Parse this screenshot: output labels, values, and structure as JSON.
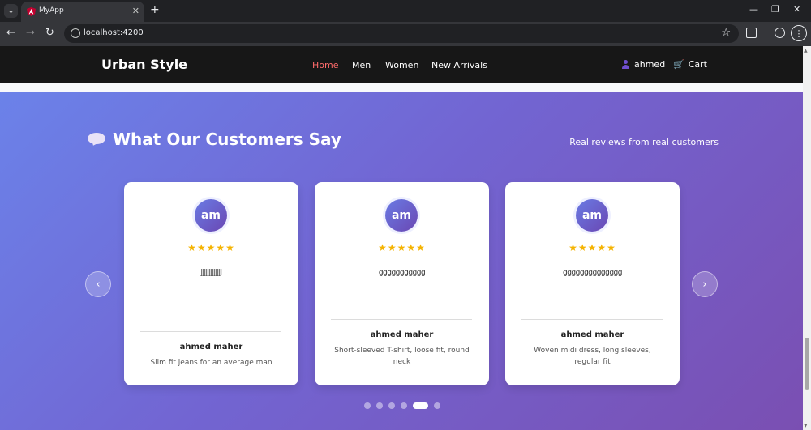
{
  "browser": {
    "tab_title": "MyApp",
    "url": "localhost:4200",
    "tab_close": "✕",
    "new_tab": "+",
    "window": {
      "minimize": "—",
      "maximize": "❐",
      "close": "✕"
    },
    "nav": {
      "back": "←",
      "forward": "→",
      "reload": "↻"
    },
    "star": "☆",
    "menu": "⋮"
  },
  "site": {
    "brand": "Urban Style",
    "nav_links": [
      "Home",
      "Men",
      "Women",
      "New Arrivals"
    ],
    "active_link": "Home",
    "user_name": "ahmed",
    "cart_label": "Cart",
    "cart_icon_glyph": "🛒"
  },
  "reviews": {
    "title": "What Our Customers Say",
    "subtitle": "Real reviews from real customers",
    "prev": "‹",
    "next": "›",
    "cards": [
      {
        "initials": "am",
        "stars": "★★★★★",
        "rating": 5,
        "text": "jjjjjjjjjjjjj",
        "reviewer": "ahmed maher",
        "product": "Slim fit jeans for an average man"
      },
      {
        "initials": "am",
        "stars": "★★★★★",
        "rating": 5,
        "text": "ggggggggggg",
        "reviewer": "ahmed maher",
        "product": "Short-sleeved T-shirt, loose fit, round neck"
      },
      {
        "initials": "am",
        "stars": "★★★★★",
        "rating": 5,
        "text": "gggggggggggggg",
        "reviewer": "ahmed maher",
        "product": "Woven midi dress, long sleeves, regular fit"
      }
    ],
    "dots": {
      "count": 6,
      "active": 5
    }
  },
  "colors": {
    "nav_bg": "#171717",
    "active_link": "#ff6b6b",
    "gradient_start": "#6b82e9",
    "gradient_end": "#7a4fb2",
    "star": "#f5b301"
  }
}
